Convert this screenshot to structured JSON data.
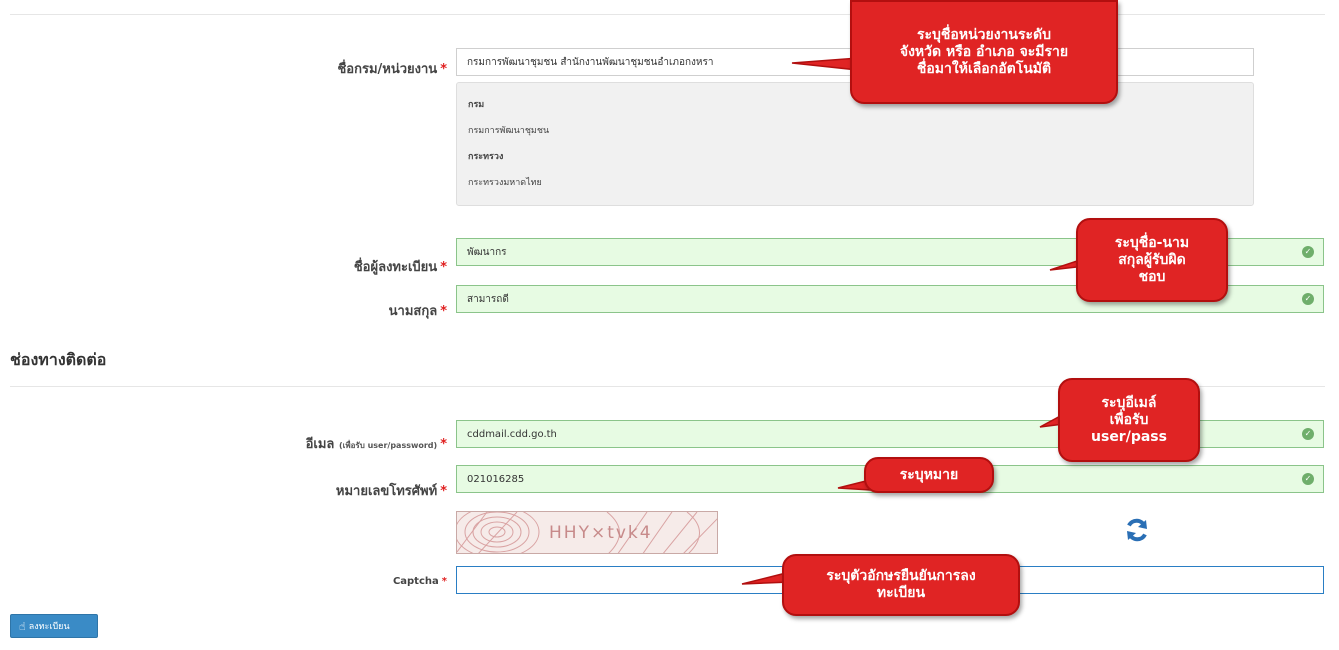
{
  "form": {
    "department": {
      "label": "ชื่อกรม/หน่วยงาน",
      "required": "*",
      "value": "กรมการพัฒนาชุมชน สำนักงานพัฒนาชุมชนอำเภอกงหรา"
    },
    "org_info": {
      "dept_heading": "กรม",
      "dept_value": "กรมการพัฒนาชุมชน",
      "ministry_heading": "กระทรวง",
      "ministry_value": "กระทรวงมหาดไทย"
    },
    "first_name": {
      "label": "ชื่อผู้ลงทะเบียน",
      "required": "*",
      "value": "พัฒนากร"
    },
    "last_name": {
      "label": "นามสกุล",
      "required": "*",
      "value": "สามารถดี"
    },
    "contact_section_title": "ช่องทางติดต่อ",
    "email": {
      "label": "อีเมล",
      "hint": "(เพื่อรับ user/password)",
      "required": "*",
      "value": "cddmail.cdd.go.th"
    },
    "phone": {
      "label": "หมายเลขโทรศัพท์",
      "required": "*",
      "value": "021016285"
    },
    "captcha": {
      "image_text": "HHY×tvk4",
      "label": "Captcha",
      "required": "*",
      "value": ""
    },
    "submit_label": "ลงทะเบียน"
  },
  "callouts": {
    "department": [
      "ระบุชื่อหน่วยงานระดับ",
      "จังหวัด หรือ อำเภอ จะมีราย",
      "ชื่อมาให้เลือกอัตโนมัติ"
    ],
    "name": [
      "ระบุชื่อ-นาม",
      "สกุลผู้รับผิด",
      "ชอบ"
    ],
    "email": [
      "ระบุอีเมล์",
      "เพื่อรับ",
      "user/pass"
    ],
    "phone": [
      "ระบุหมาย"
    ],
    "captcha": [
      "ระบุตัวอักษรยืนยันการลง",
      "ทะเบียน"
    ]
  },
  "colors": {
    "valid_bg": "#e7fbe3",
    "callout_red": "#e02424",
    "button_blue": "#3a8bc6",
    "required_red": "#e02020"
  },
  "icons": [
    "check-circle-icon",
    "refresh-icon",
    "hand-pointer-icon"
  ]
}
